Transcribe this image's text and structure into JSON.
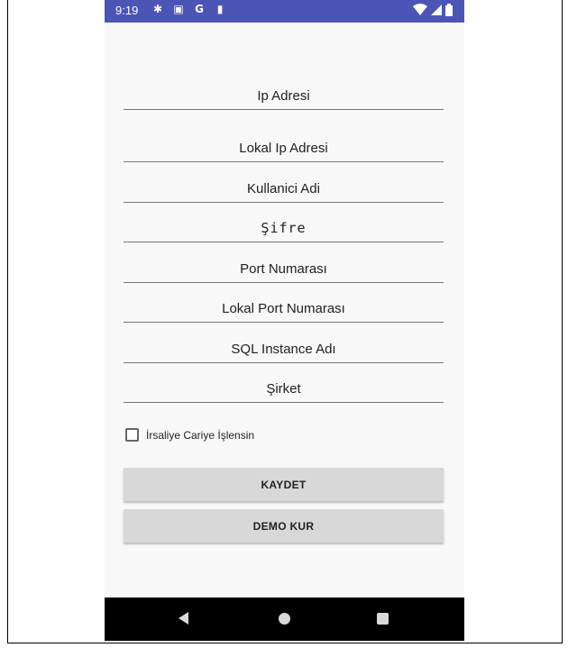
{
  "status_bar": {
    "time": "9:19",
    "left_icons": [
      "gear-icon",
      "calendar-icon",
      "google-g-icon",
      "sd-card-icon"
    ],
    "right_icons": [
      "wifi-icon",
      "signal-icon",
      "battery-icon"
    ]
  },
  "form": {
    "fields": [
      {
        "label": "Ip Adresi"
      },
      {
        "label": "Lokal Ip Adresi"
      },
      {
        "label": "Kullanici Adi"
      },
      {
        "label": "Şifre"
      },
      {
        "label": "Port Numarası"
      },
      {
        "label": "Lokal Port Numarası"
      },
      {
        "label": "SQL Instance Adı"
      },
      {
        "label": "Şirket"
      }
    ],
    "checkbox": {
      "label": "İrsaliye Cariye İşlensin",
      "checked": false
    },
    "buttons": {
      "save": "KAYDET",
      "demo": "DEMO KUR"
    }
  },
  "nav": {
    "icons": [
      "back-icon",
      "home-icon",
      "recents-icon"
    ]
  },
  "colors": {
    "status_bar": "#4b55b6",
    "button_bg": "#d8d8d8",
    "nav_bar": "#000000"
  }
}
